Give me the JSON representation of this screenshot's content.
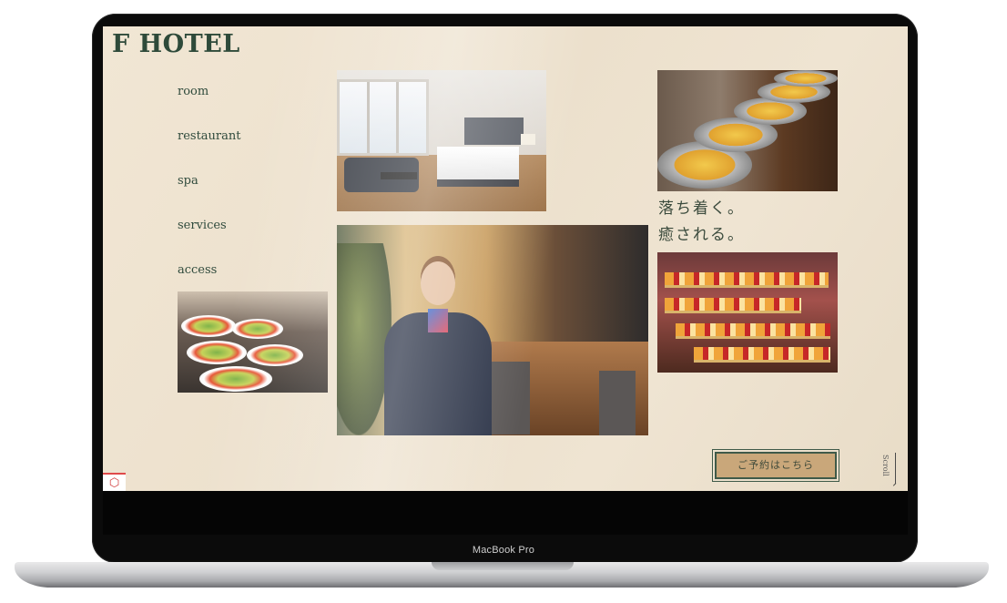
{
  "device": {
    "label": "MacBook Pro"
  },
  "site": {
    "logo": "F HOTEL",
    "nav": [
      {
        "label": "room"
      },
      {
        "label": "restaurant"
      },
      {
        "label": "spa"
      },
      {
        "label": "services"
      },
      {
        "label": "access"
      }
    ],
    "tagline": {
      "line1": "落ち着く。",
      "line2": "癒される。"
    },
    "reserve_button": "ご予約はこちら",
    "scroll_label": "Scroll",
    "corner_icon": "laravel-icon",
    "images": [
      {
        "name": "room-photo"
      },
      {
        "name": "buffet-photo"
      },
      {
        "name": "salad-photo"
      },
      {
        "name": "staff-photo"
      },
      {
        "name": "dessert-photo"
      }
    ],
    "colors": {
      "background": "#efe4d2",
      "text": "#2e4a3a",
      "button": "#c9a77a"
    }
  }
}
